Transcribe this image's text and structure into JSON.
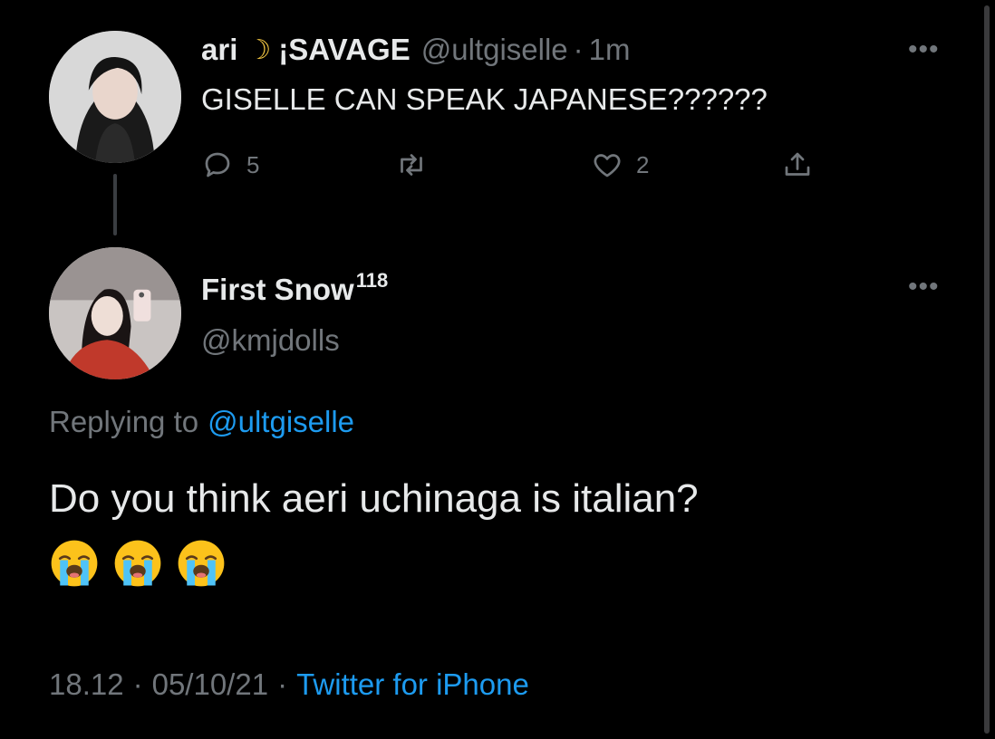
{
  "parent_tweet": {
    "display_name": "ari",
    "moon_glyph": "☽",
    "name_suffix": "¡SAVAGE",
    "handle": "@ultgiselle",
    "separator": "·",
    "time": "1m",
    "more_glyph": "•••",
    "text": "GISELLE CAN SPEAK JAPANESE??????",
    "actions": {
      "reply_icon": "reply-icon",
      "reply_count": "5",
      "retweet_icon": "retweet-icon",
      "like_icon": "heart-icon",
      "like_count": "2",
      "share_icon": "share-icon"
    }
  },
  "reply_tweet": {
    "display_name": "First Snow",
    "name_superscript": "118",
    "handle": "@kmjdolls",
    "more_glyph": "•••",
    "replying_prefix": "Replying to",
    "replying_handle": "@ultgiselle",
    "text": "Do you think aeri uchinaga is italian?",
    "emoji": [
      "loudly-crying-face",
      "loudly-crying-face",
      "loudly-crying-face"
    ],
    "timestamp_time": "18.12",
    "dot1": "·",
    "timestamp_date": "05/10/21",
    "dot2": "·",
    "source": "Twitter for iPhone"
  },
  "colors": {
    "background": "#000000",
    "text_primary": "#e7e9ea",
    "text_muted": "#71767b",
    "link": "#1d9bf0"
  }
}
